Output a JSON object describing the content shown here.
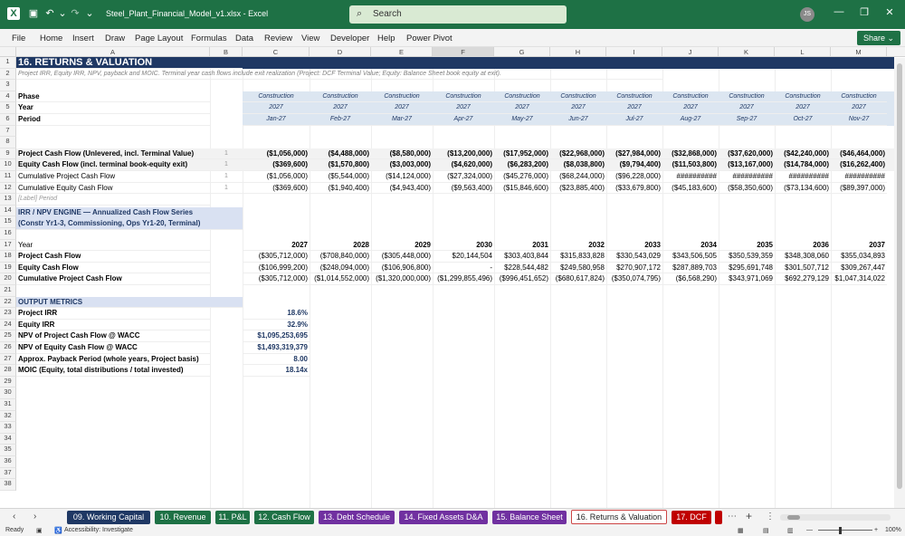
{
  "window": {
    "filename": "Steel_Plant_Financial_Model_v1.xlsx - Excel",
    "search_placeholder": "Search",
    "avatar": "JS"
  },
  "menu": [
    "File",
    "Home",
    "Insert",
    "Draw",
    "Page Layout",
    "Formulas",
    "Data",
    "Review",
    "View",
    "Developer",
    "Help",
    "Power Pivot"
  ],
  "share_label": "Share",
  "columns": [
    "A",
    "B",
    "C",
    "D",
    "E",
    "F",
    "G",
    "H",
    "I",
    "J",
    "K",
    "L",
    "M"
  ],
  "rows": {
    "r1": "16. RETURNS & VALUATION",
    "r2": "Project IRR, Equity IRR, NPV, payback and MOIC. Terminal year cash flows include exit realization (Project: DCF Terminal Value; Equity: Balance Sheet book equity at exit).",
    "phase_label": "Phase",
    "year_label": "Year",
    "period_label": "Period",
    "phase": [
      "Construction",
      "Construction",
      "Construction",
      "Construction",
      "Construction",
      "Construction",
      "Construction",
      "Construction",
      "Construction",
      "Construction",
      "Construction"
    ],
    "year": [
      "2027",
      "2027",
      "2027",
      "2027",
      "2027",
      "2027",
      "2027",
      "2027",
      "2027",
      "2027",
      "2027"
    ],
    "period": [
      "Jan-27",
      "Feb-27",
      "Mar-27",
      "Apr-27",
      "May-27",
      "Jun-27",
      "Jul-27",
      "Aug-27",
      "Sep-27",
      "Oct-27",
      "Nov-27"
    ],
    "r9_label": "Project Cash Flow (Unlevered, incl. Terminal Value)",
    "r9": [
      "($1,056,000)",
      "($4,488,000)",
      "($8,580,000)",
      "($13,200,000)",
      "($17,952,000)",
      "($22,968,000)",
      "($27,984,000)",
      "($32,868,000)",
      "($37,620,000)",
      "($42,240,000)",
      "($46,464,000)"
    ],
    "r10_label": "Equity Cash Flow (incl. terminal book-equity exit)",
    "r10": [
      "($369,600)",
      "($1,570,800)",
      "($3,003,000)",
      "($4,620,000)",
      "($6,283,200)",
      "($8,038,800)",
      "($9,794,400)",
      "($11,503,800)",
      "($13,167,000)",
      "($14,784,000)",
      "($16,262,400)"
    ],
    "r11_label": "Cumulative Project Cash Flow",
    "r11": [
      "($1,056,000)",
      "($5,544,000)",
      "($14,124,000)",
      "($27,324,000)",
      "($45,276,000)",
      "($68,244,000)",
      "($96,228,000)",
      "##########",
      "##########",
      "##########",
      "##########"
    ],
    "r12_label": "Cumulative Equity Cash Flow",
    "r12": [
      "($369,600)",
      "($1,940,400)",
      "($4,943,400)",
      "($9,563,400)",
      "($15,846,600)",
      "($23,885,400)",
      "($33,679,800)",
      "($45,183,600)",
      "($58,350,600)",
      "($73,134,600)",
      "($89,397,000)"
    ],
    "r13": "[Label] Period",
    "r15": "IRR / NPV ENGINE — Annualized Cash Flow Series (Constr Yr1-3, Commissioning, Ops Yr1-20, Terminal)",
    "r17_label": "Year",
    "r17": [
      "2027",
      "2028",
      "2029",
      "2030",
      "2031",
      "2032",
      "2033",
      "2034",
      "2035",
      "2036",
      "2037"
    ],
    "r18_label": "Project Cash Flow",
    "r18": [
      "($305,712,000)",
      "($708,840,000)",
      "($305,448,000)",
      "$20,144,504",
      "$303,403,844",
      "$315,833,828",
      "$330,543,029",
      "$343,506,505",
      "$350,539,359",
      "$348,308,060",
      "$355,034,893"
    ],
    "r19_label": "Equity Cash Flow",
    "r19": [
      "($106,999,200)",
      "($248,094,000)",
      "($106,906,800)",
      "-",
      "$228,544,482",
      "$249,580,958",
      "$270,907,172",
      "$287,889,703",
      "$295,691,748",
      "$301,507,712",
      "$309,267,447"
    ],
    "r20_label": "Cumulative Project Cash Flow",
    "r20": [
      "($305,712,000)",
      "($1,014,552,000)",
      "($1,320,000,000)",
      "($1,299,855,496)",
      "($996,451,652)",
      "($680,617,824)",
      "($350,074,795)",
      "($6,568,290)",
      "$343,971,069",
      "$692,279,129",
      "$1,047,314,022"
    ],
    "r22": "OUTPUT METRICS",
    "metrics": [
      {
        "label": "Project IRR",
        "value": "18.6%"
      },
      {
        "label": "Equity IRR",
        "value": "32.9%"
      },
      {
        "label": "NPV of Project Cash Flow @ WACC",
        "value": "$1,095,253,695"
      },
      {
        "label": "NPV of Equity Cash Flow @ WACC",
        "value": "$1,493,319,379"
      },
      {
        "label": "Approx. Payback Period (whole years, Project basis)",
        "value": "8.00"
      },
      {
        "label": "MOIC (Equity, total distributions / total invested)",
        "value": "18.14x"
      }
    ],
    "b_unit": "1"
  },
  "tabs": [
    {
      "label": "09. Working Capital",
      "color": "#1f3864"
    },
    {
      "label": "10. Revenue",
      "color": "#1e7145"
    },
    {
      "label": "11. P&L",
      "color": "#1e7145"
    },
    {
      "label": "12. Cash Flow",
      "color": "#1e7145"
    },
    {
      "label": "13. Debt Schedule",
      "color": "#7030a0"
    },
    {
      "label": "14. Fixed Assets D&A",
      "color": "#7030a0"
    },
    {
      "label": "15. Balance Sheet",
      "color": "#7030a0"
    },
    {
      "label": "16. Returns & Valuation",
      "color": "#ffffff"
    },
    {
      "label": "17. DCF",
      "color": "#c00000"
    }
  ],
  "status": {
    "ready": "Ready",
    "accessibility": "Accessibility: Investigate",
    "zoom": "100%"
  },
  "colors": {
    "excel_green": "#1e7145",
    "header_navy": "#1f3864",
    "date_band": "#dce6f1",
    "section_band": "#d9e1f2",
    "blue_text": "#1f3864"
  }
}
